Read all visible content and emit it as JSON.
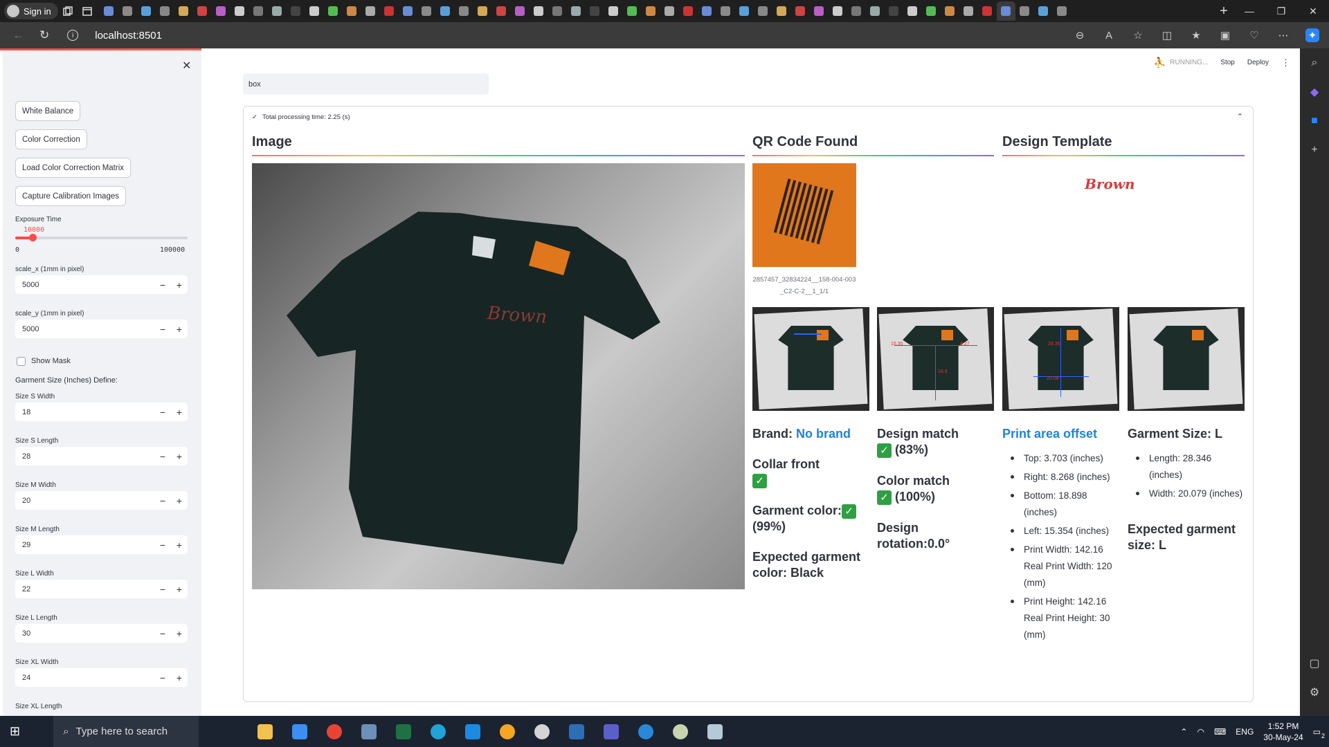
{
  "browser": {
    "sign_in": "Sign in",
    "url": "localhost:8501",
    "tab_count": 52
  },
  "header": {
    "running": "RUNNING...",
    "stop": "Stop",
    "deploy": "Deploy"
  },
  "sidebar": {
    "buttons": [
      "White Balance",
      "Color Correction",
      "Load Color Correction Matrix",
      "Capture Calibration Images"
    ],
    "exposure": {
      "label": "Exposure Time",
      "value": "10000",
      "min": "0",
      "max": "100000",
      "fraction": 0.1
    },
    "scale_x": {
      "label": "scale_x (1mm in pixel)",
      "value": "5000"
    },
    "scale_y": {
      "label": "scale_y (1mm in pixel)",
      "value": "5000"
    },
    "show_mask": "Show Mask",
    "size_header": "Garment Size (Inches) Define:",
    "sizes": [
      {
        "label": "Size S Width",
        "value": "18"
      },
      {
        "label": "Size S Length",
        "value": "28"
      },
      {
        "label": "Size M Width",
        "value": "20"
      },
      {
        "label": "Size M Length",
        "value": "29"
      },
      {
        "label": "Size L Width",
        "value": "22"
      },
      {
        "label": "Size L Length",
        "value": "30"
      },
      {
        "label": "Size XL Width",
        "value": "24"
      },
      {
        "label": "Size XL Length",
        "value": ""
      }
    ]
  },
  "search": {
    "value": "box"
  },
  "expander": {
    "title": "Total processing time: 2.25 (s)"
  },
  "columns": {
    "image": "Image",
    "qr": "QR Code Found",
    "template": "Design Template"
  },
  "qr_caption": "2857457_32834224__158-004-003_C2-C-2__1_1/1",
  "template_logo": "Brown",
  "annotations": {
    "a1": "15.35",
    "a2": "8.27",
    "a3": "18.9",
    "a4": "28.35",
    "a5": "20.08"
  },
  "results": {
    "brand_label": "Brand:",
    "brand_value": "No brand",
    "collar": "Collar front",
    "garment_color": "Garment color:",
    "garment_color_pct": "(99%)",
    "expected_color": "Expected garment color: Black",
    "design_match": "Design match",
    "design_match_pct": "(83%)",
    "color_match": "Color match",
    "color_match_pct": "(100%)",
    "design_rotation": "Design rotation:0.0°",
    "print_offset_title": "Print area offset",
    "offsets": [
      "Top: 3.703 (inches)",
      "Right: 8.268 (inches)",
      "Bottom: 18.898 (inches)",
      "Left: 15.354 (inches)",
      "Print Width: 142.16 Real Print Width: 120 (mm)",
      "Print Height: 142.16 Real Print Height: 30 (mm)"
    ],
    "garment_size_title": "Garment Size: L",
    "sizes_measured": [
      "Length: 28.346 (inches)",
      "Width: 20.079 (inches)"
    ],
    "expected_size": "Expected garment size: L"
  },
  "taskbar": {
    "search_placeholder": "Type here to search",
    "time": "1:52 PM",
    "date": "30-May-24",
    "lang": "ENG",
    "notif": "2"
  }
}
